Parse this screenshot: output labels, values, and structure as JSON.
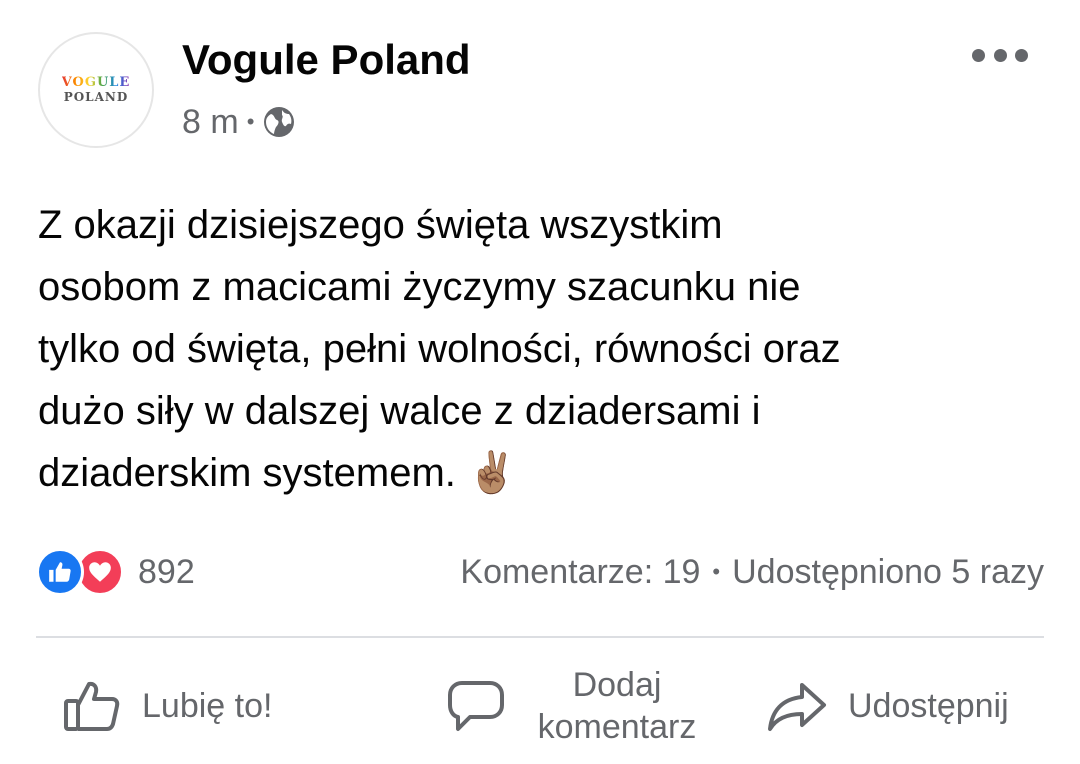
{
  "post": {
    "author": {
      "name": "Vogule Poland",
      "avatar_text_top": "VOGULE",
      "avatar_text_bottom": "POLAND"
    },
    "time": "8 m",
    "separator": "•",
    "audience_icon": "globe-icon",
    "menu_icon": "more-horizontal-icon",
    "text": "Z okazji dzisiejszego święta wszystkim\nosobom z macicami życzymy szacunku nie\ntylko od święta, pełni wolności, równości oraz\ndużo siły w dalszej walce z dziadersami i\ndziaderskim systemem. ",
    "emoji": "✌🏽",
    "reactions": {
      "icons": [
        "like-reaction-icon",
        "love-reaction-icon"
      ],
      "count": "892"
    },
    "comments_label": "Komentarze: 19",
    "stats_separator": "•",
    "shares_label": "Udostępniono 5 razy",
    "actions": {
      "like": "Lubię to!",
      "comment": "Dodaj\nkomentarz",
      "share": "Udostępnij"
    }
  },
  "colors": {
    "secondary_text": "#65676b",
    "like_blue": "#1877f2",
    "love_red": "#f33e58"
  }
}
